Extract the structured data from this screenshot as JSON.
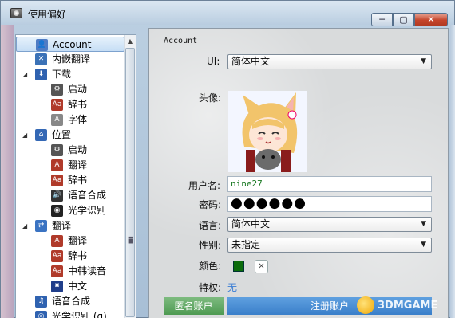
{
  "window": {
    "title": "使用偏好",
    "min_label": "─",
    "max_label": "▢",
    "close_label": "✕"
  },
  "sidebar": {
    "items": [
      {
        "label": "Account",
        "level": 0,
        "icon": "account-icon",
        "color": "#4f7cc4",
        "glyph": "👤"
      },
      {
        "label": "内嵌翻译",
        "level": 0,
        "icon": "embedded-translate-icon",
        "color": "#3b72b7",
        "glyph": "✕"
      },
      {
        "label": "下载",
        "level": 0,
        "expand": "◢",
        "icon": "download-icon",
        "color": "#2f62b0",
        "glyph": "⬇"
      },
      {
        "label": "启动",
        "level": 1,
        "icon": "gear-icon",
        "color": "#555555",
        "glyph": "⚙"
      },
      {
        "label": "辞书",
        "level": 1,
        "icon": "dictionary-icon",
        "color": "#b03a2a",
        "glyph": "Aa"
      },
      {
        "label": "字体",
        "level": 1,
        "icon": "font-icon",
        "color": "#888888",
        "glyph": "A"
      },
      {
        "label": "位置",
        "level": 0,
        "expand": "◢",
        "icon": "location-icon",
        "color": "#3468b5",
        "glyph": "⌂"
      },
      {
        "label": "启动",
        "level": 1,
        "icon": "gear-icon",
        "color": "#555555",
        "glyph": "⚙"
      },
      {
        "label": "翻译",
        "level": 1,
        "icon": "translate-icon",
        "color": "#b03a2a",
        "glyph": "A"
      },
      {
        "label": "辞书",
        "level": 1,
        "icon": "dictionary-icon",
        "color": "#b03a2a",
        "glyph": "Aa"
      },
      {
        "label": "语音合成",
        "level": 1,
        "icon": "speaker-icon",
        "color": "#333333",
        "glyph": "🔊"
      },
      {
        "label": "光学识别",
        "level": 1,
        "icon": "ocr-icon",
        "color": "#222222",
        "glyph": "◉"
      },
      {
        "label": "翻译",
        "level": 0,
        "expand": "◢",
        "icon": "translate-group-icon",
        "color": "#3a73c2",
        "glyph": "⇄"
      },
      {
        "label": "翻译",
        "level": 1,
        "icon": "translate-icon",
        "color": "#b03a2a",
        "glyph": "A"
      },
      {
        "label": "辞书",
        "level": 1,
        "icon": "dictionary-icon",
        "color": "#b03a2a",
        "glyph": "Aa"
      },
      {
        "label": "中韩读音",
        "level": 1,
        "icon": "korean-reading-icon",
        "color": "#b03a2a",
        "glyph": "Aa"
      },
      {
        "label": "中文",
        "level": 1,
        "icon": "chinese-icon",
        "color": "#1f3d8a",
        "glyph": "✸"
      },
      {
        "label": "语音合成",
        "level": 0,
        "icon": "speech-synthesis-icon",
        "color": "#2f62b0",
        "glyph": "♫"
      },
      {
        "label": "光学识别 (g)",
        "level": 0,
        "icon": "ocr-group-icon",
        "color": "#2f62b0",
        "glyph": "◎"
      }
    ]
  },
  "account": {
    "group_label": "Account",
    "ui_label": "UI:",
    "ui_value": "简体中文",
    "avatar_label": "头像:",
    "username_label": "用户名:",
    "username_value": "nine27",
    "password_label": "密码:",
    "password_value": "●●●●●●",
    "language_label": "语言:",
    "language_value": "简体中文",
    "gender_label": "性别:",
    "gender_value": "未指定",
    "color_label": "颜色:",
    "color_value": "#0b6c0b",
    "privilege_label": "特权:",
    "privilege_value": "无",
    "anon_button": "匿名账户",
    "register_button": "注册账户",
    "dropdown_glyph": "▼",
    "clear_glyph": "✕"
  },
  "watermark": {
    "text": "3DMGAME"
  }
}
